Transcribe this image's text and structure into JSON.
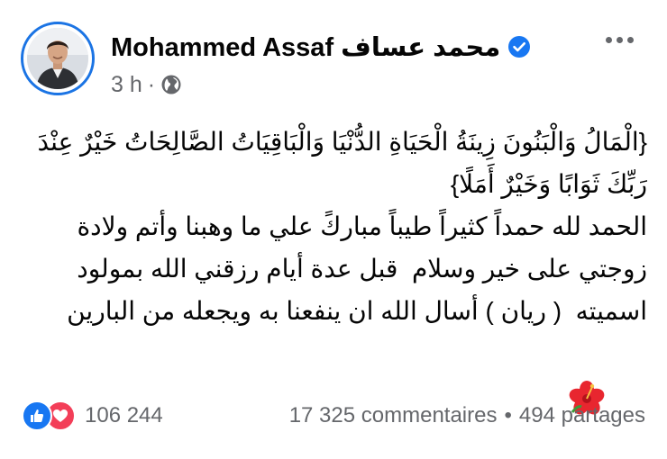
{
  "post": {
    "author_name": "محمد عساف Mohammed Assaf",
    "time": "3 h",
    "separator": "·",
    "icons": {
      "verified": "verified-badge-icon",
      "audience": "globe-icon",
      "more": "more-options-icon",
      "like": "like-reaction-icon",
      "love": "love-reaction-icon",
      "flower": "hibiscus-emoji"
    },
    "colors": {
      "accent": "#1877f2",
      "secondary_text": "#65676b",
      "love": "#f33e58"
    },
    "text": {
      "line1": "{الْمَالُ وَالْبَنُونَ زِينَةُ الْحَيَاةِ الدُّنْيَا وَالْبَاقِيَاتُ الصَّالِحَاتُ خَيْرٌ عِنْدَ رَبِّكَ ثَوَابًا وَخَيْرٌ أَمَلًا}",
      "line2": "الحمد لله حمداً كثيراً طيباً مباركً علي ما وهبنا وأتم ولادة زوجتي على خير وسلام  قبل عدة أيام رزقني الله بمولود اسميته  ( ريان ) أسال الله ان ينفعنا به ويجعله من البارين"
    },
    "footer": {
      "reaction_count": "106 244",
      "comments": "17 325 commentaires",
      "bullet": "•",
      "shares": "494 partages"
    }
  }
}
